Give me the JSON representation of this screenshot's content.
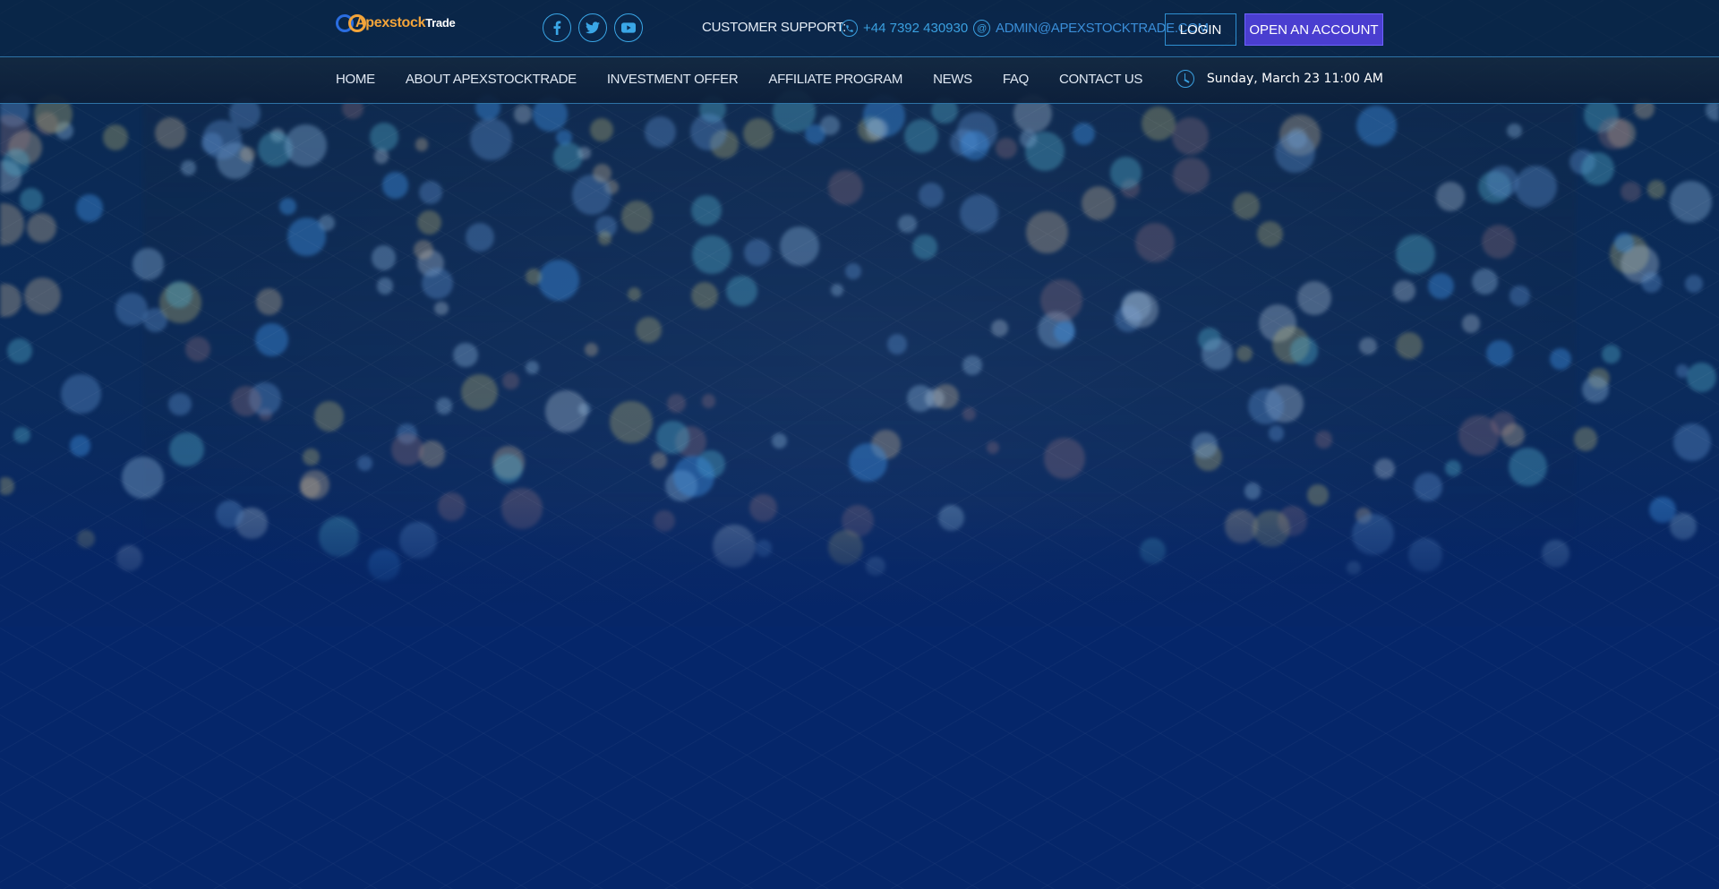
{
  "brand": {
    "logo_text_primary": "Apexstock",
    "logo_text_secondary": "Trade",
    "logo_icon": "interlocking-rings-logo",
    "colors": {
      "primary": "#2a6de0",
      "accent": "#f3a43a"
    }
  },
  "topbar": {
    "socials": [
      {
        "name": "facebook",
        "icon": "facebook-icon"
      },
      {
        "name": "twitter",
        "icon": "twitter-icon"
      },
      {
        "name": "youtube",
        "icon": "youtube-icon"
      }
    ],
    "support_label": "CUSTOMER SUPPORT:",
    "phone": "+44 7392 430930",
    "phone_icon": "phone-icon",
    "email": "ADMIN@APEXSTOCKTRADE.COM",
    "email_icon": "at-icon",
    "login_label": "LOGIN",
    "open_account_label": "OPEN AN ACCOUNT",
    "open_account_color": "#4a3ed0"
  },
  "nav": {
    "items": [
      {
        "label": "HOME"
      },
      {
        "label": "ABOUT APEXSTOCKTRADE"
      },
      {
        "label": "INVESTMENT OFFER"
      },
      {
        "label": "AFFILIATE PROGRAM"
      },
      {
        "label": "NEWS"
      },
      {
        "label": "FAQ"
      },
      {
        "label": "CONTACT US"
      }
    ],
    "datetime": "Sunday, March 23 11:00 AM",
    "clock_icon": "clock-icon"
  },
  "theme": {
    "background": "#05266a",
    "link_color": "#3aa0e0"
  }
}
